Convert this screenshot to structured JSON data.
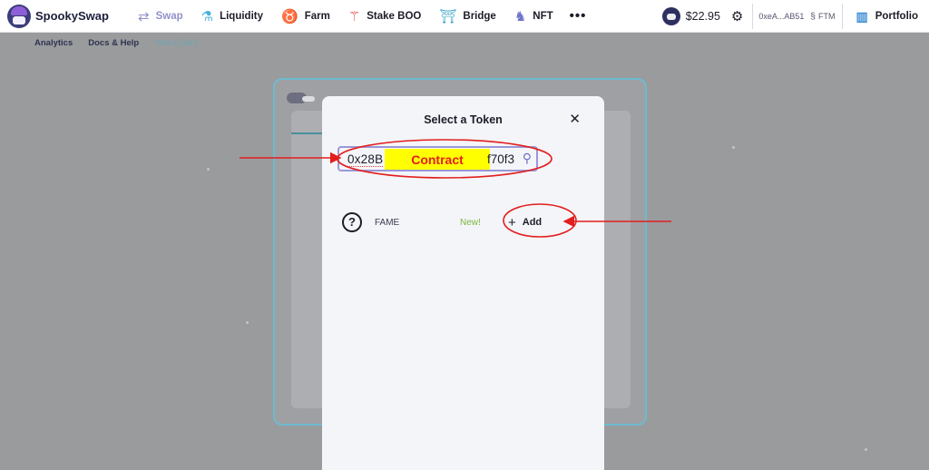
{
  "brand": {
    "name": "SpookySwap"
  },
  "nav": {
    "swap": "Swap",
    "liquidity": "Liquidity",
    "farm": "Farm",
    "stake": "Stake BOO",
    "bridge": "Bridge",
    "nft": "NFT",
    "more": "•••"
  },
  "account": {
    "boo_price": "$22.95",
    "wallet_address": "0xeA...AB51",
    "network": "FTM",
    "portfolio": "Portfolio"
  },
  "subnav": {
    "analytics": "Analytics",
    "docs": "Docs & Help",
    "vote": "Vote (Live!)"
  },
  "modal": {
    "title": "Select a Token",
    "search_head": "0x28B",
    "search_tail": "f70f3",
    "redaction_label": "Contract",
    "token": {
      "name": "FAME",
      "badge": "New!",
      "add_label": "Add",
      "icon_glyph": "?"
    }
  },
  "colors": {
    "accent": "#8f91c9",
    "annotation_red": "#e21e1e",
    "highlight_yellow": "#ffff00",
    "new_badge": "#78b83d"
  }
}
